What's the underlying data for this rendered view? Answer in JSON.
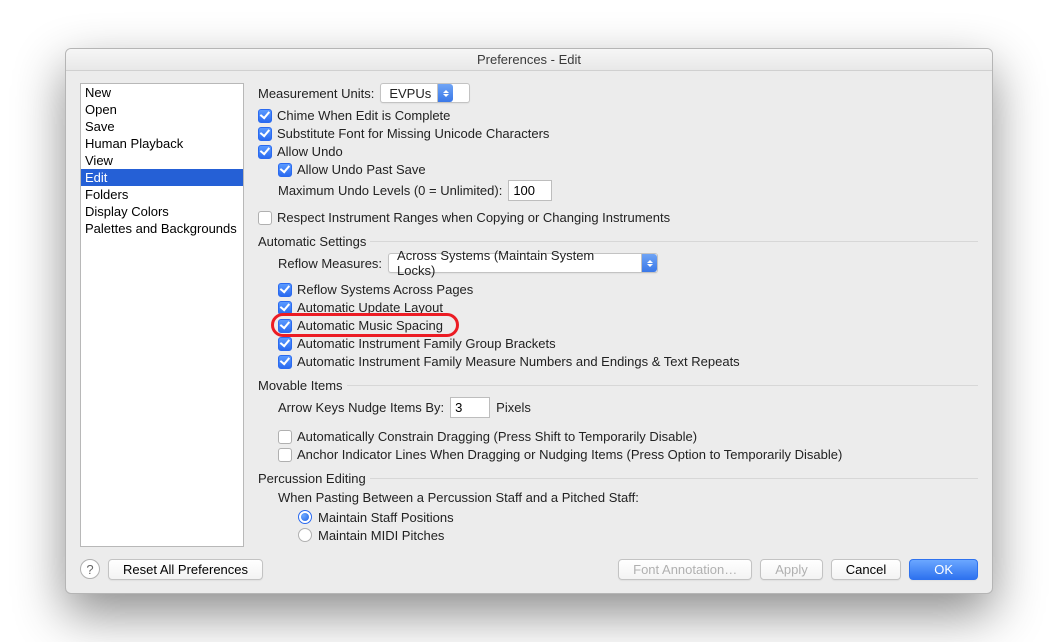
{
  "title": "Preferences - Edit",
  "sidebar": {
    "items": [
      {
        "label": "New"
      },
      {
        "label": "Open"
      },
      {
        "label": "Save"
      },
      {
        "label": "Human Playback"
      },
      {
        "label": "View"
      },
      {
        "label": "Edit"
      },
      {
        "label": "Folders"
      },
      {
        "label": "Display Colors"
      },
      {
        "label": "Palettes and Backgrounds"
      }
    ],
    "selected_index": 5
  },
  "measurement": {
    "label": "Measurement Units:",
    "value": "EVPUs"
  },
  "chime": {
    "label": "Chime When Edit is Complete",
    "checked": true
  },
  "subfont": {
    "label": "Substitute Font for Missing Unicode Characters",
    "checked": true
  },
  "allow_undo": {
    "label": "Allow Undo",
    "checked": true
  },
  "undo_past_save": {
    "label": "Allow Undo Past Save",
    "checked": true
  },
  "max_undo": {
    "label": "Maximum Undo Levels (0 = Unlimited):",
    "value": "100"
  },
  "respect_ranges": {
    "label": "Respect Instrument Ranges when Copying or Changing Instruments",
    "checked": false
  },
  "auto_settings_header": "Automatic Settings",
  "reflow_measures": {
    "label": "Reflow Measures:",
    "value": "Across Systems (Maintain System Locks)"
  },
  "reflow_systems": {
    "label": "Reflow Systems Across Pages",
    "checked": true
  },
  "auto_update": {
    "label": "Automatic Update Layout",
    "checked": true
  },
  "auto_spacing": {
    "label": "Automatic Music Spacing",
    "checked": true
  },
  "auto_brackets": {
    "label": "Automatic Instrument Family Group Brackets",
    "checked": true
  },
  "auto_measure_nums": {
    "label": "Automatic Instrument Family Measure Numbers and Endings & Text Repeats",
    "checked": true
  },
  "movable_header": "Movable Items",
  "nudge": {
    "label": "Arrow Keys Nudge Items By:",
    "value": "3",
    "suffix": "Pixels"
  },
  "auto_constrain": {
    "label": "Automatically Constrain Dragging (Press Shift to Temporarily Disable)",
    "checked": false
  },
  "anchor_lines": {
    "label": "Anchor Indicator Lines When Dragging or Nudging Items (Press Option to Temporarily Disable)",
    "checked": false
  },
  "percussion_header": "Percussion Editing",
  "paste_between": "When Pasting Between a Percussion Staff and a Pitched Staff:",
  "maintain_staff": {
    "label": "Maintain Staff Positions",
    "checked": true
  },
  "maintain_midi": {
    "label": "Maintain MIDI Pitches",
    "checked": false
  },
  "footer": {
    "reset": "Reset All Preferences",
    "font_annotation": "Font Annotation…",
    "apply": "Apply",
    "cancel": "Cancel",
    "ok": "OK"
  }
}
